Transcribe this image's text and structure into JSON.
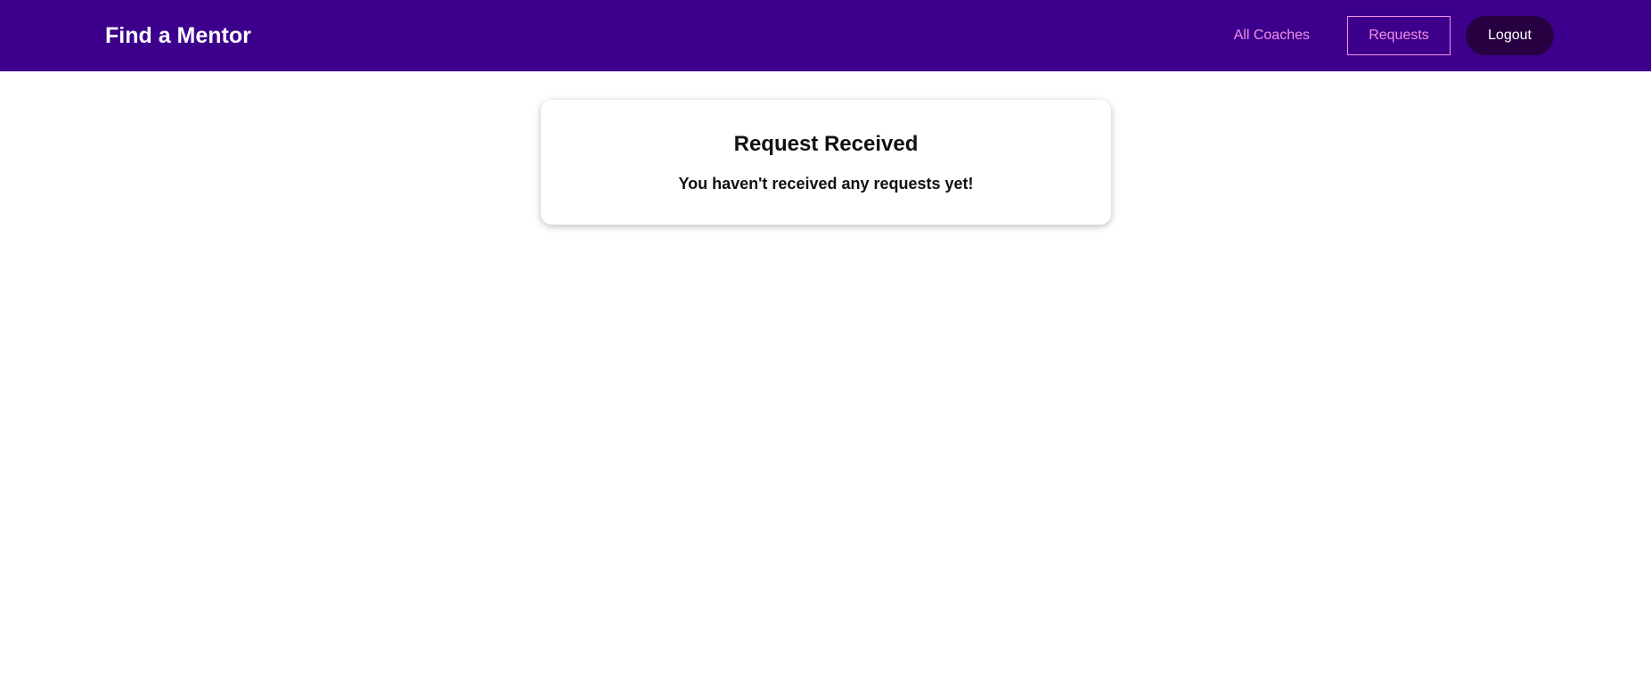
{
  "header": {
    "brand": "Find a Mentor",
    "nav": {
      "all_coaches": "All Coaches",
      "requests": "Requests",
      "logout": "Logout"
    },
    "colors": {
      "background": "#3d008d",
      "link": "#f391e3",
      "logout_background": "#270041"
    }
  },
  "main": {
    "card": {
      "title": "Request Received",
      "message": "You haven't received any requests yet!"
    }
  }
}
